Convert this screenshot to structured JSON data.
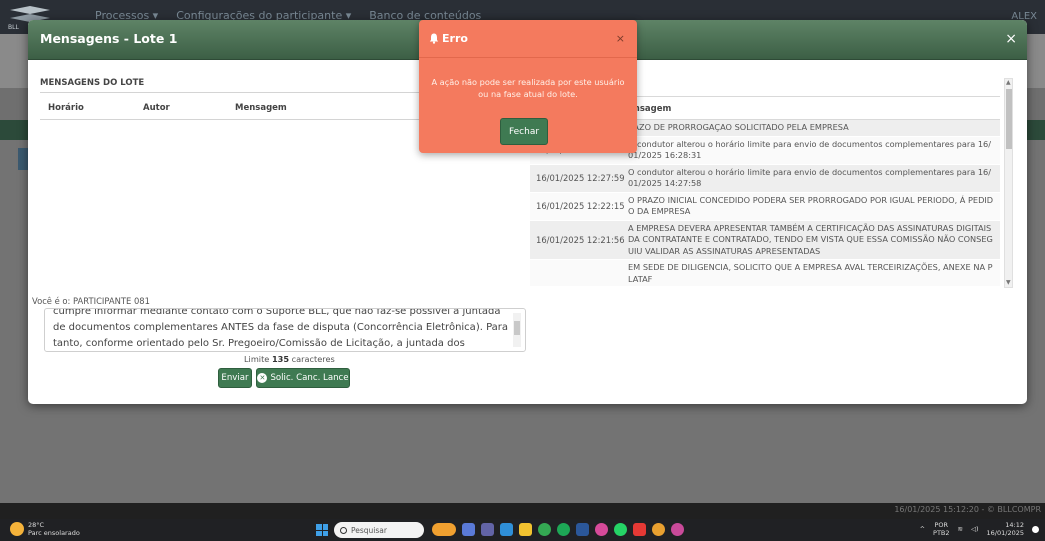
{
  "background_app": {
    "nav": [
      "Processos ▾",
      "Configurações do participante ▾",
      "Banco de conteúdos"
    ],
    "user": "ALEX",
    "footer": "16/01/2025 15:12:20 - © BLLCOMPR"
  },
  "modal": {
    "title": "Mensagens - Lote 1",
    "close": "×",
    "left_panel": {
      "title": "MENSAGENS DO LOTE",
      "columns": [
        "Horário",
        "Autor",
        "Mensagem"
      ]
    },
    "right_panel": {
      "title": "O",
      "column": "ensagem",
      "rows": [
        {
          "time": "",
          "msg": "RAZO DE PRORROGAÇAO SOLICITADO PELA EMPRESA"
        },
        {
          "time": "16/01/2025 12:28:31",
          "msg": "O condutor alterou o horário limite para envio de documentos complementares para 16/01/2025 16:28:31"
        },
        {
          "time": "16/01/2025 12:27:59",
          "msg": "O condutor alterou o horário limite para envio de documentos complementares para 16/01/2025 14:27:58"
        },
        {
          "time": "16/01/2025 12:22:15",
          "msg": "O PRAZO INICIAL CONCEDIDO PODERA SER PRORROGADO POR IGUAL PERIODO, Á PEDIDO DA EMPRESA"
        },
        {
          "time": "16/01/2025 12:21:56",
          "msg": "A EMPRESA DEVERA APRESENTAR TAMBÉM A CERTIFICAÇÃO DAS ASSINATURAS DIGITAIS DA CONTRATANTE E CONTRATADO, TENDO EM VISTA QUE ESSA COMISSÃO NÃO CONSEGUIU VALIDAR AS ASSINATURAS APRESENTADAS"
        },
        {
          "time": "",
          "msg": "EM SEDE DE DILIGENCIA, SOLICITO QUE A EMPRESA AVAL TERCEIRIZAÇÕES, ANEXE NA PLATAF"
        }
      ]
    },
    "participant": "Você é o: PARTICIPANTE 081",
    "message_text": "cumpre informar mediante contato com o Suporte BLL, que não faz-se possível a juntada de documentos complementares ANTES da fase de disputa (Concorrência Eletrônica). Para tanto, conforme orientado pelo Sr. Pregoeiro/Comissão de Licitação, a juntada dos documentos solicitados",
    "limit_prefix": "Limite",
    "limit_value": "135",
    "limit_suffix": "caracteres",
    "send_label": "Enviar",
    "solic_label": "Solic. Canc. Lance"
  },
  "error": {
    "title": "Erro",
    "close": "×",
    "message": "A ação não pode ser realizada por este usuário ou na fase atual do lote.",
    "button": "Fechar"
  },
  "taskbar": {
    "temperature": "28°C",
    "weather": "Parc ensolarado",
    "search": "Pesquisar",
    "lang1": "POR",
    "lang2": "PTB2",
    "time": "14:12",
    "date": "16/01/2025"
  },
  "colors": {
    "header_green": "#4a7055",
    "button_green": "#3f7a52",
    "error_bg": "#f47a5e"
  }
}
